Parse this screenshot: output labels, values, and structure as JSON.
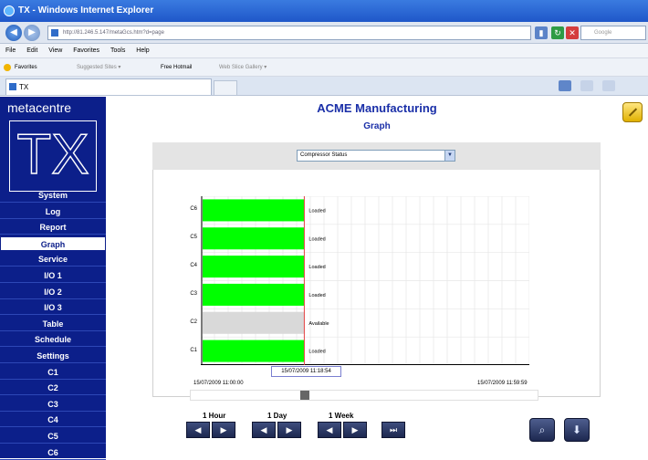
{
  "browser": {
    "window_title": "TX - Windows Internet Explorer",
    "url": "http://81.246.5.147/metaGcs.htm?d=page",
    "search_placeholder": "Google",
    "menu": [
      "File",
      "Edit",
      "View",
      "Favorites",
      "Tools",
      "Help"
    ],
    "favorites_bar": {
      "favorites_label": "Favorites",
      "items": [
        "Suggested Sites ▾",
        "Free Hotmail",
        "Web Slice Gallery ▾"
      ]
    },
    "tab_title": "TX"
  },
  "sidebar": {
    "brand": "metacentre",
    "logo_text": "TX",
    "items": [
      {
        "label": "System"
      },
      {
        "label": "Log"
      },
      {
        "label": "Report"
      },
      {
        "label": "Graph",
        "active": true
      },
      {
        "label": "Service"
      },
      {
        "label": "I/O 1"
      },
      {
        "label": "I/O 2"
      },
      {
        "label": "I/O 3"
      },
      {
        "label": "Table"
      },
      {
        "label": "Schedule"
      },
      {
        "label": "Settings"
      },
      {
        "label": "C1"
      },
      {
        "label": "C2"
      },
      {
        "label": "C3"
      },
      {
        "label": "C4"
      },
      {
        "label": "C5"
      },
      {
        "label": "C6"
      }
    ]
  },
  "main": {
    "title": "ACME Manufacturing",
    "subtitle": "Graph",
    "selected_series": "Compressor Status",
    "start_time": "15/07/2009 11:00:00",
    "end_time": "15/07/2009 11:59:59",
    "cursor_time": "15/07/2009 11:18:54",
    "cursor_position": 0.315
  },
  "chart_data": {
    "type": "bar",
    "rows": [
      {
        "name": "C6",
        "state": "Loaded",
        "color": "#00ff00"
      },
      {
        "name": "C5",
        "state": "Loaded",
        "color": "#00ff00"
      },
      {
        "name": "C4",
        "state": "Loaded",
        "color": "#00ff00"
      },
      {
        "name": "C3",
        "state": "Loaded",
        "color": "#00ff00"
      },
      {
        "name": "C2",
        "state": "Available",
        "color": "#d9d9d9"
      },
      {
        "name": "C1",
        "state": "Loaded",
        "color": "#00ff00"
      }
    ],
    "bar_end_fraction": 0.315
  },
  "controls": {
    "hour_label": "1 Hour",
    "day_label": "1 Day",
    "week_label": "1 Week"
  }
}
